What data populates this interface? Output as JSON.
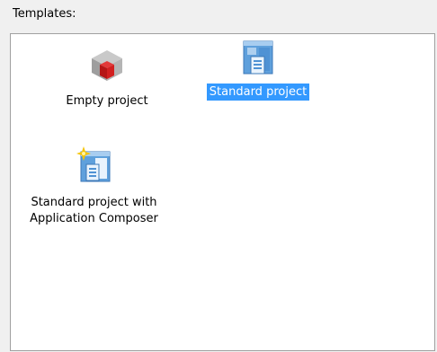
{
  "templates_label": "Templates:",
  "templates": [
    {
      "label": "Empty project",
      "icon": "red-cube-icon",
      "selected": false
    },
    {
      "label": "Standard project",
      "icon": "standard-project-icon",
      "selected": true
    },
    {
      "label": "Standard project with Application Composer",
      "label_line1": "Standard project with",
      "label_line2": "Application Composer",
      "icon": "composer-project-icon",
      "selected": false
    }
  ],
  "colors": {
    "selection": "#3399ff",
    "list_background": "#ffffff",
    "dialog_background": "#f0f0f0",
    "border": "#a0a0a0"
  }
}
